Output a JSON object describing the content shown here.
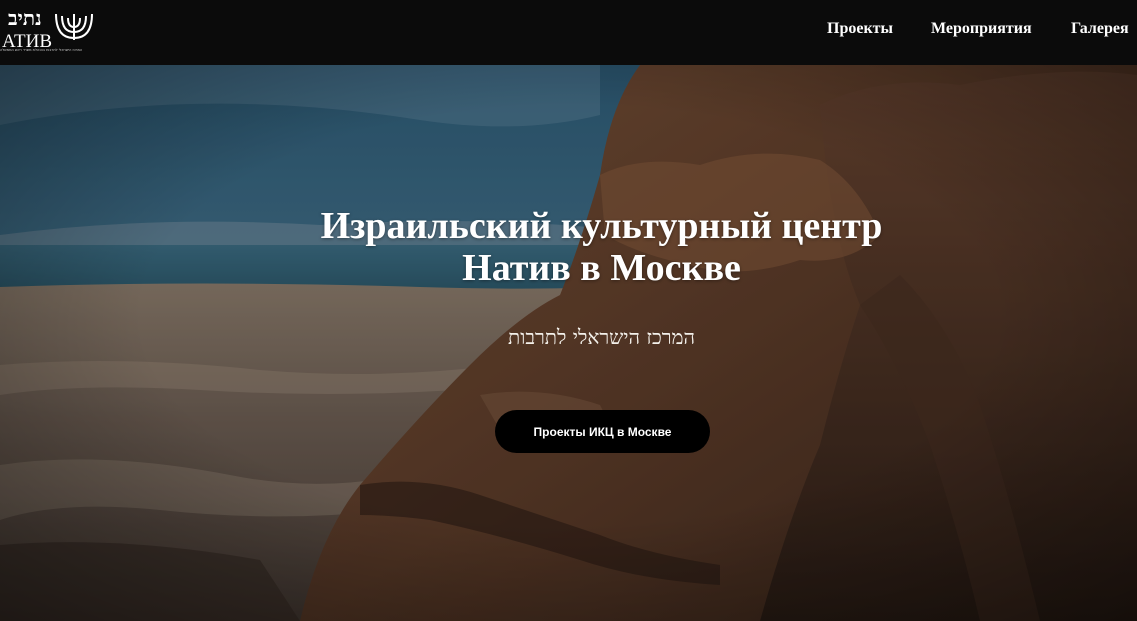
{
  "header": {
    "logo": {
      "hebrew": "נתיב",
      "cyrillic": "АТИВ",
      "tagline": "המרכז הישראלי לתרבות בהנהלת משרד ראש הממשלה",
      "icon": "menorah-icon"
    },
    "nav": [
      {
        "label": "Проекты"
      },
      {
        "label": "Мероприятия"
      },
      {
        "label": "Галерея"
      }
    ]
  },
  "hero": {
    "title_line1": "Израильский культурный центр",
    "title_line2": "Натив в Москве",
    "subtitle": "המרכז הישראלי לתרבות",
    "button_label": "Проекты ИКЦ в Москве",
    "background": "masada-landscape-photo"
  },
  "colors": {
    "header_bg": "#0b0b0b",
    "button_bg": "#000000",
    "text": "#ffffff"
  }
}
